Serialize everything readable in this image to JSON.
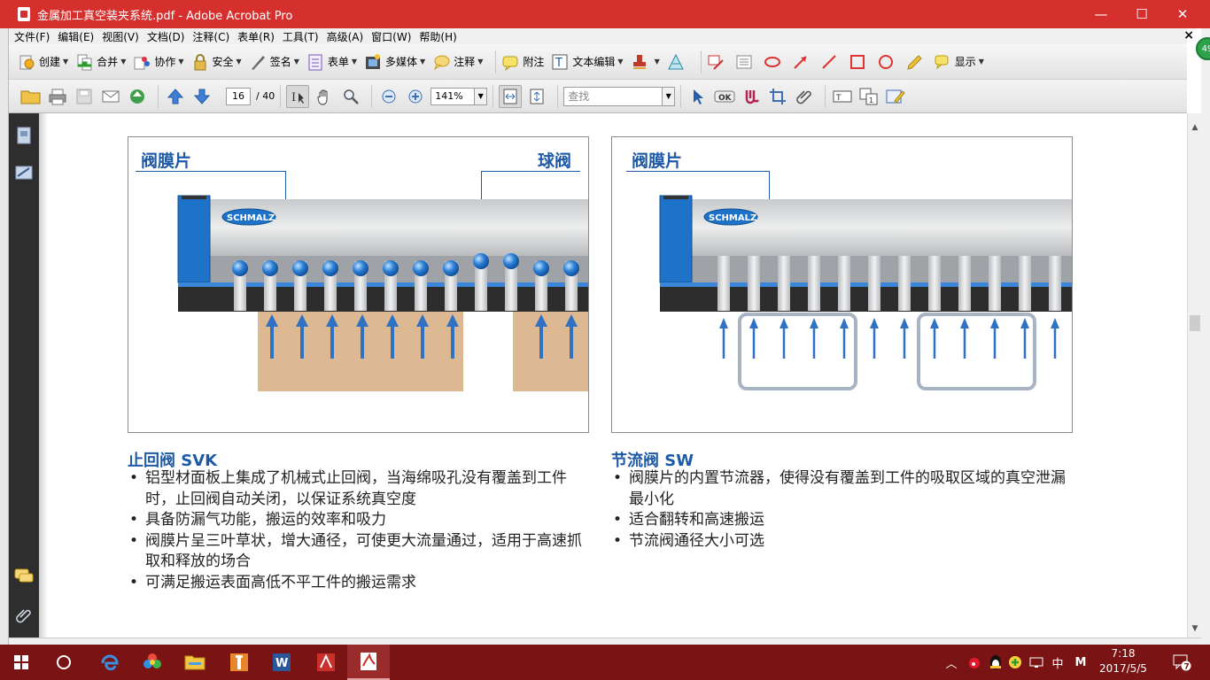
{
  "window": {
    "title": "金属加工真空装夹系统.pdf - Adobe Acrobat Pro",
    "minimize": "—",
    "maximize": "☐",
    "close": "✕"
  },
  "menubar": [
    "文件(F)",
    "编辑(E)",
    "视图(V)",
    "文档(D)",
    "注释(C)",
    "表单(R)",
    "工具(T)",
    "高级(A)",
    "窗口(W)",
    "帮助(H)"
  ],
  "menubar_close": "×",
  "toolbar1": {
    "create": "创建",
    "combine": "合并",
    "collaborate": "协作",
    "secure": "安全",
    "sign": "签名",
    "forms": "表单",
    "multimedia": "多媒体",
    "comment": "注释",
    "sticky_note": "附注",
    "text_edit": "文本编辑",
    "show": "显示"
  },
  "toolbar2": {
    "page_current": "16",
    "page_total": "/ 40",
    "zoom": "141%",
    "search_placeholder": "查找"
  },
  "badge": "49",
  "doc": {
    "left_panel": {
      "label_left": "阀膜片",
      "label_right": "球阀",
      "logo": "SCHMALZ"
    },
    "right_panel": {
      "label_left": "阀膜片",
      "logo": "SCHMALZ"
    },
    "left_section": {
      "title": "止回阀 SVK",
      "bullets": [
        "铝型材面板上集成了机械式止回阀，当海绵吸孔没有覆盖到工件时，止回阀自动关闭，以保证系统真空度",
        "具备防漏气功能，搬运的效率和吸力",
        "阀膜片呈三叶草状，增大通径，可使更大流量通过，适用于高速抓取和释放的场合",
        "可满足搬运表面高低不平工件的搬运需求"
      ]
    },
    "right_section": {
      "title": "节流阀 SW",
      "bullets": [
        "阀膜片的内置节流器，使得没有覆盖到工件的吸取区域的真空泄漏最小化",
        "适合翻转和高速搬运",
        "节流阀通径大小可选"
      ]
    }
  },
  "taskbar": {
    "ime": "中",
    "ime2": "M",
    "time": "7:18",
    "date": "2017/5/5",
    "notifications": "7"
  },
  "colors": {
    "titlebar": "#d6302e",
    "accent_blue": "#1f5aa6",
    "taskbar": "#7a1313"
  }
}
